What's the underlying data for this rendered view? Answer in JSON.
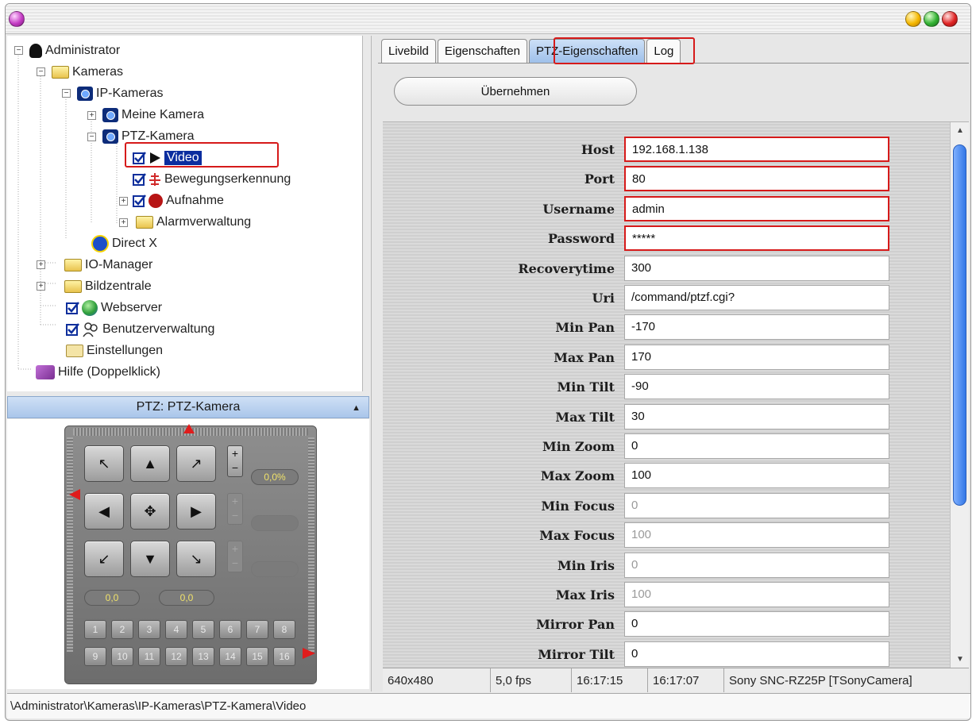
{
  "window": {
    "title": ""
  },
  "tree": {
    "items": [
      {
        "label": "Administrator"
      },
      {
        "label": "Kameras"
      },
      {
        "label": "IP-Kameras"
      },
      {
        "label": "Meine Kamera"
      },
      {
        "label": "PTZ-Kamera"
      },
      {
        "label": "Video"
      },
      {
        "label": "Bewegungserkennung"
      },
      {
        "label": "Aufnahme"
      },
      {
        "label": "Alarmverwaltung"
      },
      {
        "label": "Direct X"
      },
      {
        "label": "IO-Manager"
      },
      {
        "label": "Bildzentrale"
      },
      {
        "label": "Webserver"
      },
      {
        "label": "Benutzerverwaltung"
      },
      {
        "label": "Einstellungen"
      },
      {
        "label": "Hilfe (Doppelklick)"
      }
    ],
    "selected": "Video"
  },
  "ptz": {
    "header": "PTZ: PTZ-Kamera",
    "zoom_display": "0,0%",
    "pan_display": "0,0",
    "tilt_display": "0,0",
    "presets": [
      "1",
      "2",
      "3",
      "4",
      "5",
      "6",
      "7",
      "8",
      "9",
      "10",
      "11",
      "12",
      "13",
      "14",
      "15",
      "16"
    ]
  },
  "tabs": [
    {
      "label": "Livebild"
    },
    {
      "label": "Eigenschaften"
    },
    {
      "label": "PTZ-Eigenschaften",
      "active": true
    },
    {
      "label": "Log"
    }
  ],
  "apply_label": "Übernehmen",
  "properties": [
    {
      "label": "Host",
      "value": "192.168.1.138",
      "highlighted": true
    },
    {
      "label": "Port",
      "value": "80",
      "highlighted": true
    },
    {
      "label": "Username",
      "value": "admin",
      "highlighted": true
    },
    {
      "label": "Password",
      "value": "*****",
      "highlighted": true
    },
    {
      "label": "Recoverytime",
      "value": "300"
    },
    {
      "label": "Uri",
      "value": "/command/ptzf.cgi?"
    },
    {
      "label": "Min Pan",
      "value": "-170"
    },
    {
      "label": "Max Pan",
      "value": "170"
    },
    {
      "label": "Min Tilt",
      "value": "-90"
    },
    {
      "label": "Max Tilt",
      "value": "30"
    },
    {
      "label": "Min Zoom",
      "value": "0"
    },
    {
      "label": "Max Zoom",
      "value": "100"
    },
    {
      "label": "Min Focus",
      "value": "0",
      "disabled": true
    },
    {
      "label": "Max Focus",
      "value": "100",
      "disabled": true
    },
    {
      "label": "Min Iris",
      "value": "0",
      "disabled": true
    },
    {
      "label": "Max Iris",
      "value": "100",
      "disabled": true
    },
    {
      "label": "Mirror Pan",
      "value": "0"
    },
    {
      "label": "Mirror Tilt",
      "value": "0"
    }
  ],
  "status": {
    "resolution": "640x480",
    "fps": "5,0 fps",
    "time1": "16:17:15",
    "time2": "16:17:07",
    "camera": "Sony SNC-RZ25P [TSonyCamera]"
  },
  "path": "\\Administrator\\Kameras\\IP-Kameras\\PTZ-Kamera\\Video",
  "colors": {
    "highlight": "#d61a1a",
    "selection": "#0b2d9f",
    "accent_tab": "#9fc0ea"
  }
}
